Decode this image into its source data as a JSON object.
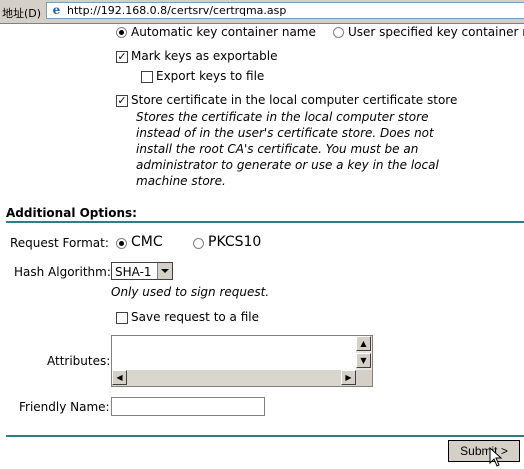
{
  "addressbar": {
    "label": "地址(D)",
    "url": "http://192.168.0.8/certsrv/certrqma.asp",
    "icon": "ie-page-icon"
  },
  "key_options": {
    "auto_container_label": "Automatic key container name",
    "user_container_label": "User specified key container n",
    "container_selected": "auto",
    "exportable_label": "Mark keys as exportable",
    "exportable_checked": true,
    "export_file_label": "Export keys to file",
    "export_file_checked": false,
    "store_local_label": "Store certificate in the local computer certificate store",
    "store_local_checked": true,
    "store_local_desc": "Stores the certificate in the local computer store instead of in the user's certificate store. Does not install the root CA's certificate. You must be an administrator to generate or use a key in the local machine store."
  },
  "additional": {
    "heading": "Additional Options:",
    "request_format_label": "Request Format:",
    "cmc_label": "CMC",
    "pkcs10_label": "PKCS10",
    "format_selected": "CMC",
    "hash_label": "Hash Algorithm:",
    "hash_value": "SHA-1",
    "hash_note": "Only used to sign request.",
    "save_request_label": "Save request to a file",
    "save_request_checked": false,
    "attributes_label": "Attributes:",
    "attributes_value": "",
    "friendly_name_label": "Friendly Name:",
    "friendly_name_value": ""
  },
  "submit_label": "Submit >",
  "colors": {
    "rule": "#2e7f84",
    "chrome": "#d4d0c8"
  }
}
